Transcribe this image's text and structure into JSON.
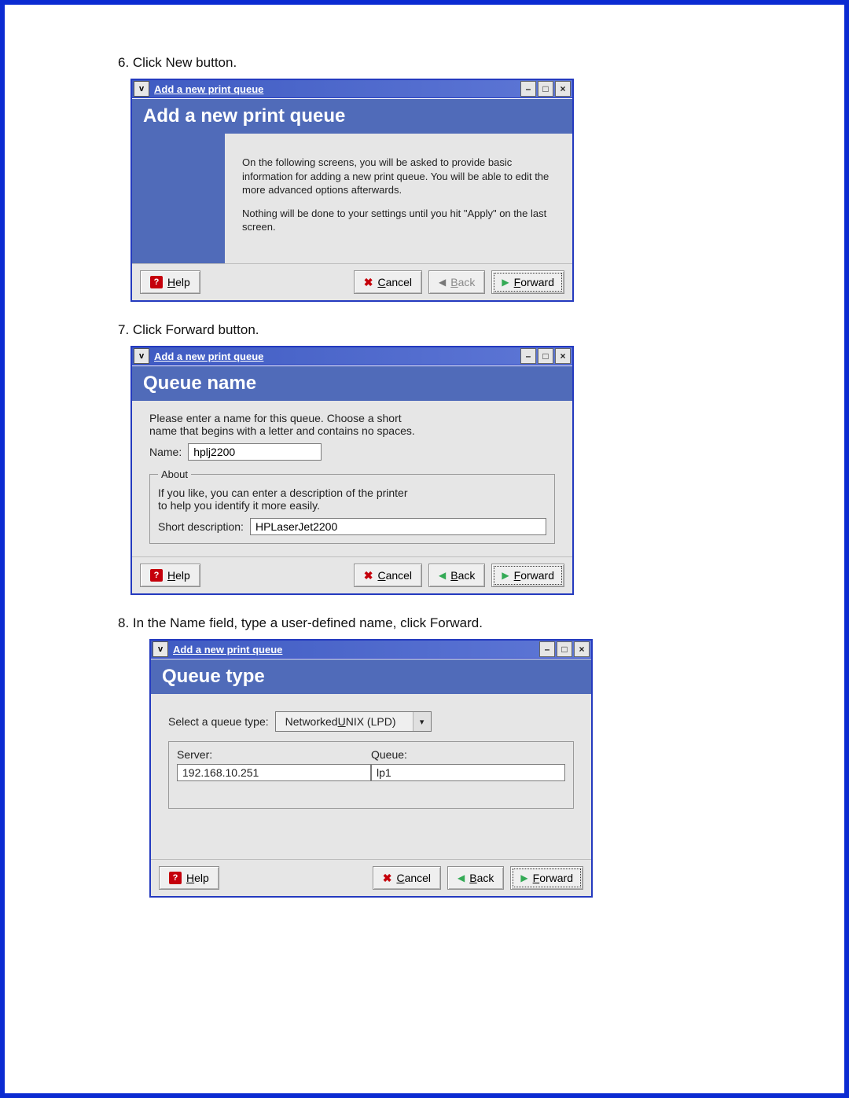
{
  "steps": {
    "s6": "6. Click New button.",
    "s7": "7. Click Forward button.",
    "s8": "8. In the Name field, type a user-defined name, click Forward."
  },
  "common": {
    "window_title": "Add a new print queue",
    "help": "Help",
    "cancel": "Cancel",
    "back": "Back",
    "forward": "Forward"
  },
  "dlg1": {
    "banner": "Add a new print queue",
    "p1": "On the following screens, you will be asked to provide basic information for adding a new print queue.  You will be able to edit the more advanced options afterwards.",
    "p2": "Nothing will be done to your settings until you hit \"Apply\" on the last screen."
  },
  "dlg2": {
    "banner": "Queue name",
    "intro1": "Please enter a name for this queue.  Choose a short",
    "intro2": "name that begins with a letter and contains no spaces.",
    "name_label": "Name:",
    "name_value": "hplj2200",
    "about_legend": "About",
    "about_p1": "If you like, you can enter a description of the printer",
    "about_p2": "to help you identify it more easily.",
    "desc_label": "Short description:",
    "desc_value": "HPLaserJet2200"
  },
  "dlg3": {
    "banner": "Queue type",
    "type_label": "Select a queue type:",
    "type_value": "Networked UNIX (LPD)",
    "server_label": "Server:",
    "queue_label": "Queue:",
    "server_value": "192.168.10.251",
    "queue_value": "lp1"
  }
}
